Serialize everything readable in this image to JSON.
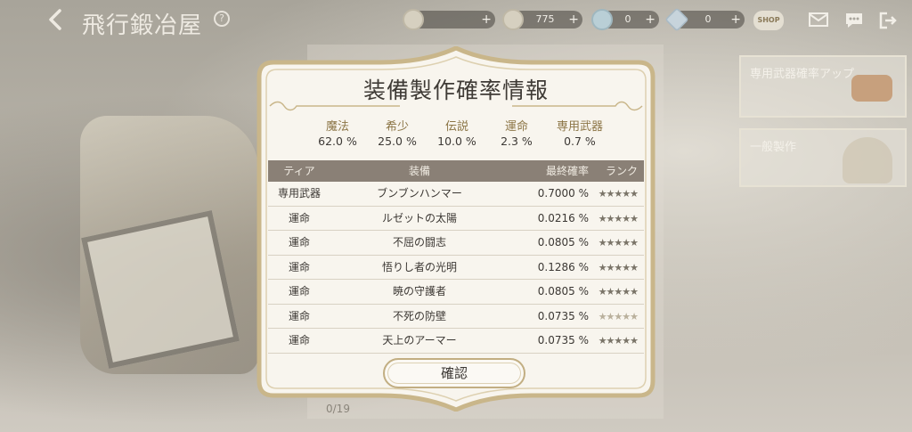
{
  "screen": {
    "title": "飛行鍛冶屋",
    "back_icon": "chevron-left-icon",
    "help_label": "?",
    "currencies": [
      {
        "name": "coin-icon",
        "value": ""
      },
      {
        "name": "gem-icon",
        "value": "775"
      },
      {
        "name": "crystal-icon",
        "value": "0"
      },
      {
        "name": "diamond-icon",
        "value": "0"
      }
    ],
    "plus_label": "+",
    "shop_label": "SHOP",
    "hud_icons": [
      "mail-icon",
      "chat-icon",
      "exit-icon"
    ],
    "side_menu": [
      {
        "label": "専用武器確率アップ"
      },
      {
        "label": "一般製作"
      }
    ],
    "counter": "0/19"
  },
  "modal": {
    "title": "装備製作確率情報",
    "rates": [
      {
        "label": "魔法",
        "value": "62.0 %"
      },
      {
        "label": "希少",
        "value": "25.0 %"
      },
      {
        "label": "伝説",
        "value": "10.0 %"
      },
      {
        "label": "運命",
        "value": "2.3 %"
      },
      {
        "label": "専用武器",
        "value": "0.7 %"
      }
    ],
    "table": {
      "headers": {
        "tier": "ティア",
        "item": "装備",
        "probability": "最終確率",
        "rank": "ランク"
      },
      "rows": [
        {
          "tier": "専用武器",
          "item": "ブンブンハンマー",
          "probability": "0.7000 %",
          "rank": "★★★★★"
        },
        {
          "tier": "運命",
          "item": "ルゼットの太陽",
          "probability": "0.0216 %",
          "rank": "★★★★★"
        },
        {
          "tier": "運命",
          "item": "不屈の闘志",
          "probability": "0.0805 %",
          "rank": "★★★★★"
        },
        {
          "tier": "運命",
          "item": "悟りし者の光明",
          "probability": "0.1286 %",
          "rank": "★★★★★"
        },
        {
          "tier": "運命",
          "item": "暁の守護者",
          "probability": "0.0805 %",
          "rank": "★★★★★"
        },
        {
          "tier": "運命",
          "item": "不死の防壁",
          "probability": "0.0735 %",
          "rank": "★★★★★"
        },
        {
          "tier": "運命",
          "item": "天上のアーマー",
          "probability": "0.0735 %",
          "rank": "★★★★★"
        }
      ]
    },
    "confirm_label": "確認"
  },
  "colors": {
    "accent_gold": "#c2ae82",
    "table_header": "#8a8076",
    "rate_label": "#8c7546"
  }
}
